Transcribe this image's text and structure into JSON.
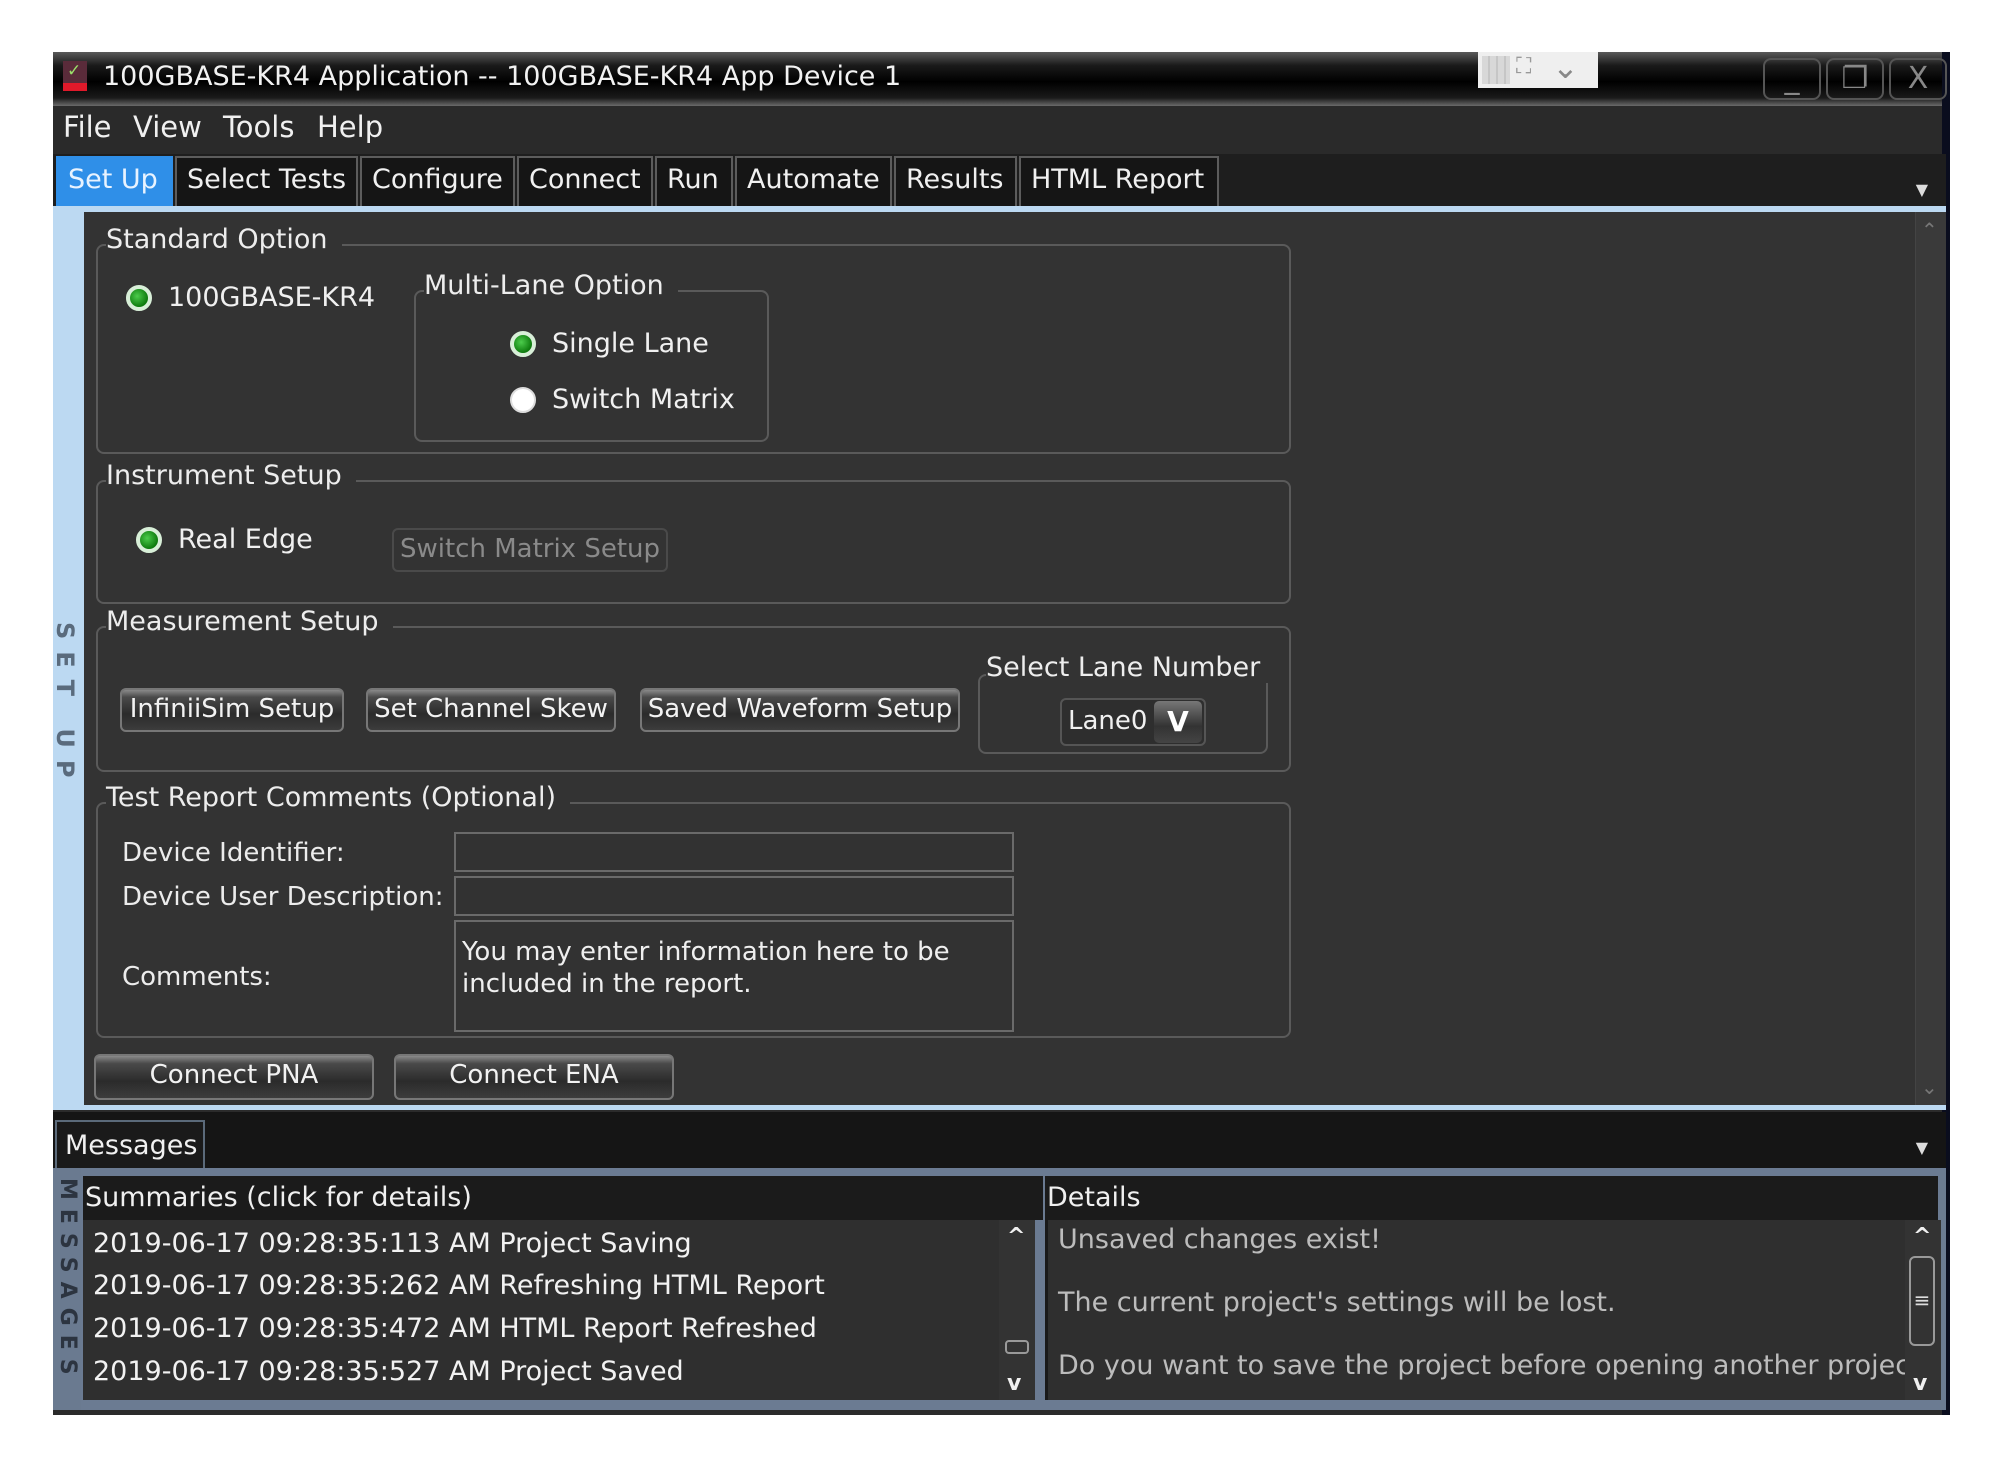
{
  "window": {
    "title": "100GBASE-KR4 Application -- 100GBASE-KR4 App Device 1",
    "app_icon": "checkmark-app-icon",
    "title_tools": [
      "grid-icon",
      "expand-icon",
      "chevron-down-icon"
    ],
    "controls": {
      "minimize": "_",
      "restore": "❐",
      "close": "X"
    }
  },
  "menu": [
    "File",
    "View",
    "Tools",
    "Help"
  ],
  "tabs": [
    {
      "label": "Set Up",
      "active": true
    },
    {
      "label": "Select Tests"
    },
    {
      "label": "Configure"
    },
    {
      "label": "Connect"
    },
    {
      "label": "Run"
    },
    {
      "label": "Automate"
    },
    {
      "label": "Results"
    },
    {
      "label": "HTML Report"
    }
  ],
  "side_label": "SET UP",
  "standard_option": {
    "legend": "Standard Option",
    "radio": {
      "label": "100GBASE-KR4",
      "selected": true
    },
    "multi_lane": {
      "legend": "Multi-Lane Option",
      "options": [
        {
          "label": "Single Lane",
          "selected": true
        },
        {
          "label": "Switch Matrix",
          "selected": false
        }
      ]
    }
  },
  "instrument_setup": {
    "legend": "Instrument Setup",
    "radio": {
      "label": "Real Edge",
      "selected": true
    },
    "switch_matrix_button": "Switch Matrix Setup"
  },
  "measurement_setup": {
    "legend": "Measurement Setup",
    "buttons": [
      "InfiniiSim Setup",
      "Set Channel Skew",
      "Saved Waveform Setup"
    ],
    "lane": {
      "legend": "Select Lane Number",
      "value": "Lane0"
    }
  },
  "test_report": {
    "legend": "Test Report Comments (Optional)",
    "device_identifier_label": "Device Identifier:",
    "device_identifier_value": "",
    "device_description_label": "Device User Description:",
    "device_description_value": "",
    "comments_label": "Comments:",
    "comments_value": "You may enter information here to be included in the report."
  },
  "connect_buttons": [
    "Connect PNA",
    "Connect ENA"
  ],
  "messages": {
    "tab": "Messages",
    "side_label": "MESSAGES",
    "summaries_header": "Summaries (click for details)",
    "details_header": "Details",
    "summaries": [
      "2019-06-17 09:28:35:113 AM Project Saving",
      "2019-06-17 09:28:35:262 AM Refreshing HTML Report",
      "2019-06-17 09:28:35:472 AM HTML Report Refreshed",
      "2019-06-17 09:28:35:527 AM Project Saved"
    ],
    "details": [
      "Unsaved changes exist!",
      "The current project's settings will be lost.",
      "Do you want to save the project before opening another project?"
    ]
  }
}
